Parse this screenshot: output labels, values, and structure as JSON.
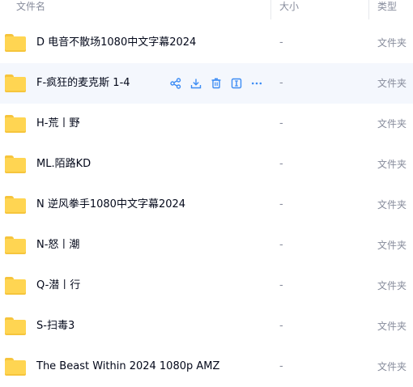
{
  "columns": {
    "name": "文件名",
    "size": "大小",
    "type": "类型"
  },
  "colors": {
    "folder_yellow": "#ffd552",
    "action_blue": "#3c8cf4",
    "row_hover": "#f4f7fd"
  },
  "files": [
    {
      "name": "D 电音不散场1080中文字幕2024",
      "size": "-",
      "type": "文件夹"
    },
    {
      "name": "F-疯狂的麦克斯 1-4",
      "size": "-",
      "type": "文件夹"
    },
    {
      "name": "H-荒丨野",
      "size": "-",
      "type": "文件夹"
    },
    {
      "name": "ML.陌路KD",
      "size": "-",
      "type": "文件夹"
    },
    {
      "name": "N 逆风拳手1080中文字幕2024",
      "size": "-",
      "type": "文件夹"
    },
    {
      "name": "N-怒丨潮",
      "size": "-",
      "type": "文件夹"
    },
    {
      "name": "Q-潜丨行",
      "size": "-",
      "type": "文件夹"
    },
    {
      "name": "S-扫毒3",
      "size": "-",
      "type": "文件夹"
    },
    {
      "name": "The Beast Within 2024 1080p AMZ",
      "size": "-",
      "type": "文件夹"
    }
  ],
  "hover_actions": [
    "share-icon",
    "download-icon",
    "delete-icon",
    "rename-icon",
    "more-icon"
  ]
}
